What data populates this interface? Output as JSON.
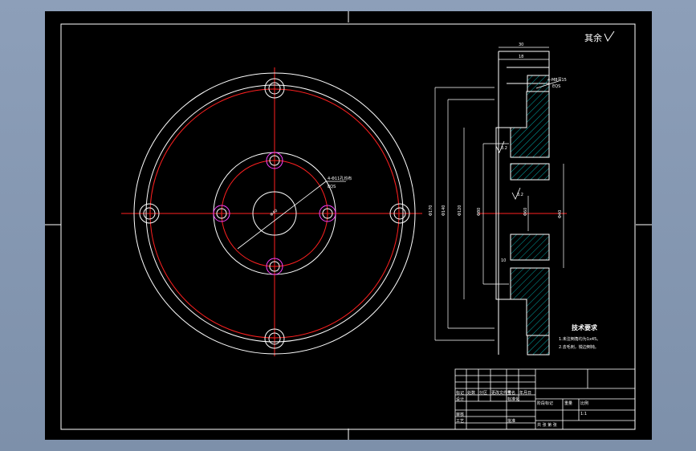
{
  "drawing": {
    "surface_note": "其余",
    "tech_req": {
      "title": "技术要求",
      "lines": [
        "1.未注倒角均为1x45。",
        "2.去毛刺，锐边倒钝。"
      ]
    },
    "front_view": {
      "bolt_note": "4-Φ11孔均布",
      "bolt_note_sub": "EQS",
      "outer_circle_count": 4,
      "inner_circle_count": 4
    },
    "section_view": {
      "callout_top": "4-M8深15",
      "callout_top_sub": "EQS",
      "dims_vertical": [
        "Φ170",
        "Φ140",
        "Φ120",
        "Φ80",
        "Φ40",
        "Φ60"
      ],
      "dims_horizontal": [
        "30",
        "18"
      ],
      "roughness_marks": [
        "3.2",
        "3.2"
      ],
      "small_dim": "10"
    },
    "title_block": {
      "rows": [
        "标记",
        "处数",
        "分区",
        "更改文件号",
        "签名",
        "年月日"
      ],
      "designer": "设计",
      "standardization": "标准化",
      "checker": "审核",
      "process": "工艺",
      "approval": "批准",
      "stage_mark": "阶段标记",
      "weight": "重量",
      "scale": "比例",
      "scale_value": "1:1",
      "sheets": "共 张 第 张"
    }
  },
  "colors": {
    "outline": "#ffffff",
    "centerline": "#ff2020",
    "hole": "#ff40ff",
    "hatch": "#00cfcf",
    "sheet": "#000000",
    "frame_bg": "#8d9fb9"
  }
}
